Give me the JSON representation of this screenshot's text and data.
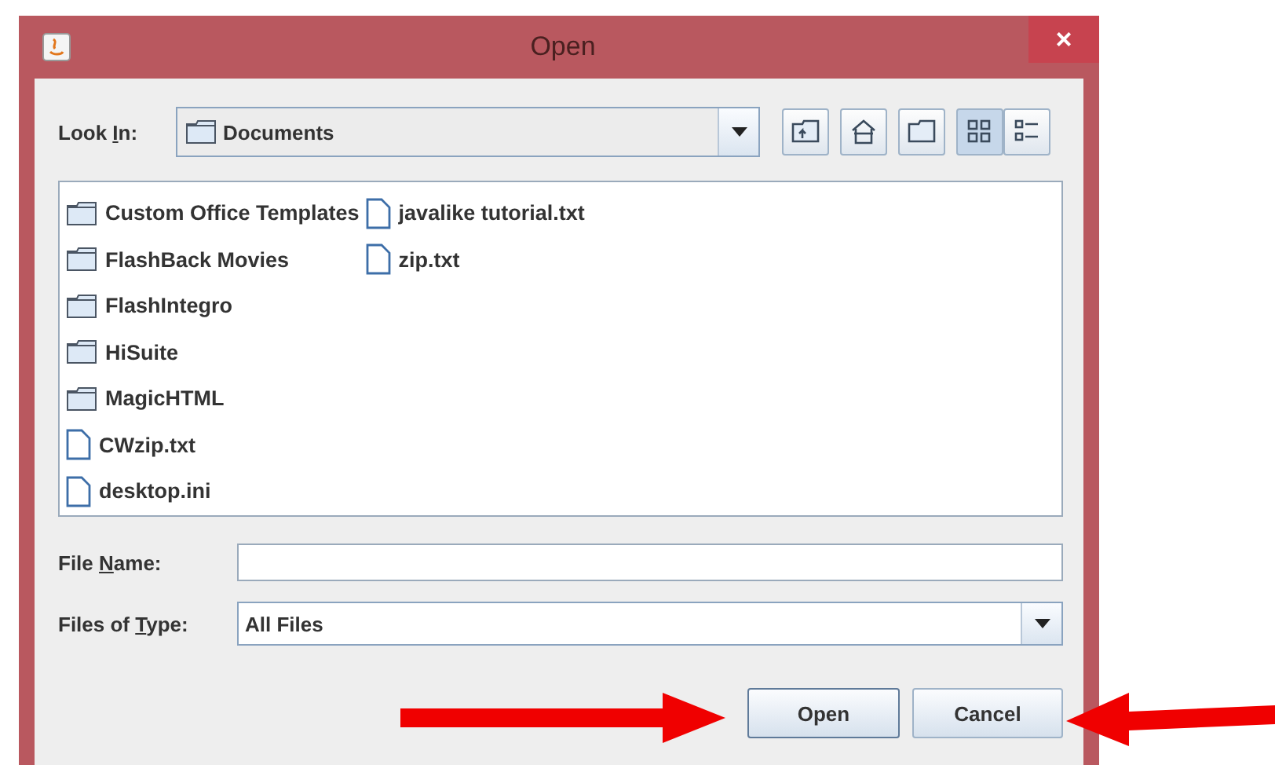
{
  "window": {
    "title": "Open",
    "close": "×"
  },
  "look_in": {
    "label": {
      "before": "Look ",
      "key": "I",
      "after": "n:"
    },
    "value": "Documents"
  },
  "view": [
    {
      "selected": true
    },
    {
      "selected": false
    }
  ],
  "files": [
    {
      "name": "Custom Office Templates",
      "kind": "folder"
    },
    {
      "name": "FlashBack Movies",
      "kind": "folder"
    },
    {
      "name": "FlashIntegro",
      "kind": "folder"
    },
    {
      "name": "HiSuite",
      "kind": "folder"
    },
    {
      "name": "MagicHTML",
      "kind": "folder"
    },
    {
      "name": "CWzip.txt",
      "kind": "file"
    },
    {
      "name": "desktop.ini",
      "kind": "file"
    },
    {
      "name": "javalike tutorial.txt",
      "kind": "file"
    },
    {
      "name": "zip.txt",
      "kind": "file"
    }
  ],
  "file_name": {
    "label": {
      "before": "File ",
      "key": "N",
      "after": "ame:"
    }
  },
  "file_type": {
    "label": {
      "before": "Files of ",
      "key": "T",
      "after": "ype:"
    },
    "value": "All Files"
  },
  "buttons": [
    "Open",
    "Cancel"
  ]
}
